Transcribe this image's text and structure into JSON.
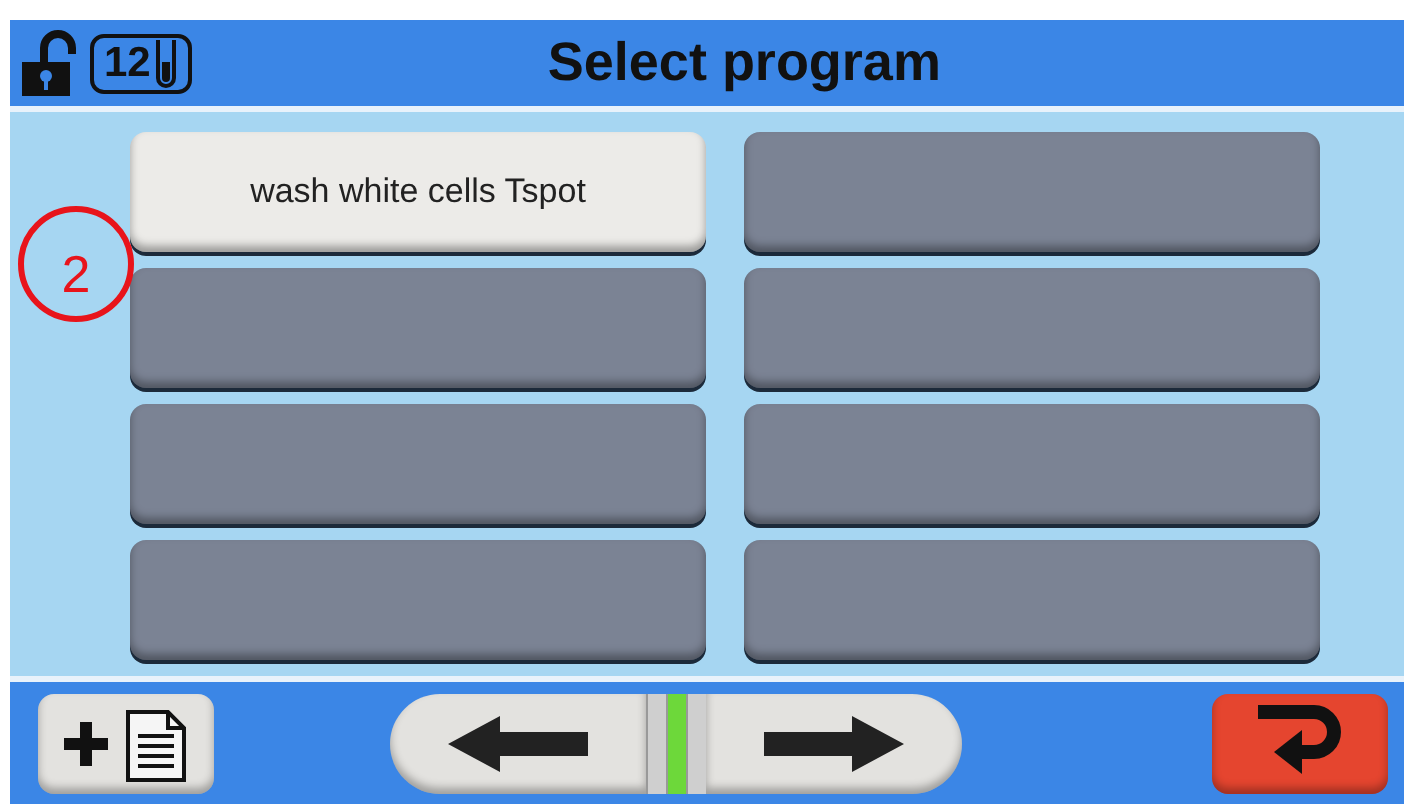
{
  "header": {
    "locked": false,
    "tube_count": "12",
    "title": "Select program"
  },
  "callout": {
    "label": "2"
  },
  "programs": [
    {
      "kind": "program",
      "label": "wash white cells Tspot"
    },
    {
      "kind": "empty"
    },
    {
      "kind": "empty"
    },
    {
      "kind": "empty"
    },
    {
      "kind": "empty"
    },
    {
      "kind": "empty"
    },
    {
      "kind": "empty"
    },
    {
      "kind": "empty"
    }
  ],
  "pager": [
    {
      "selected": false
    },
    {
      "selected": true
    },
    {
      "selected": false
    }
  ]
}
